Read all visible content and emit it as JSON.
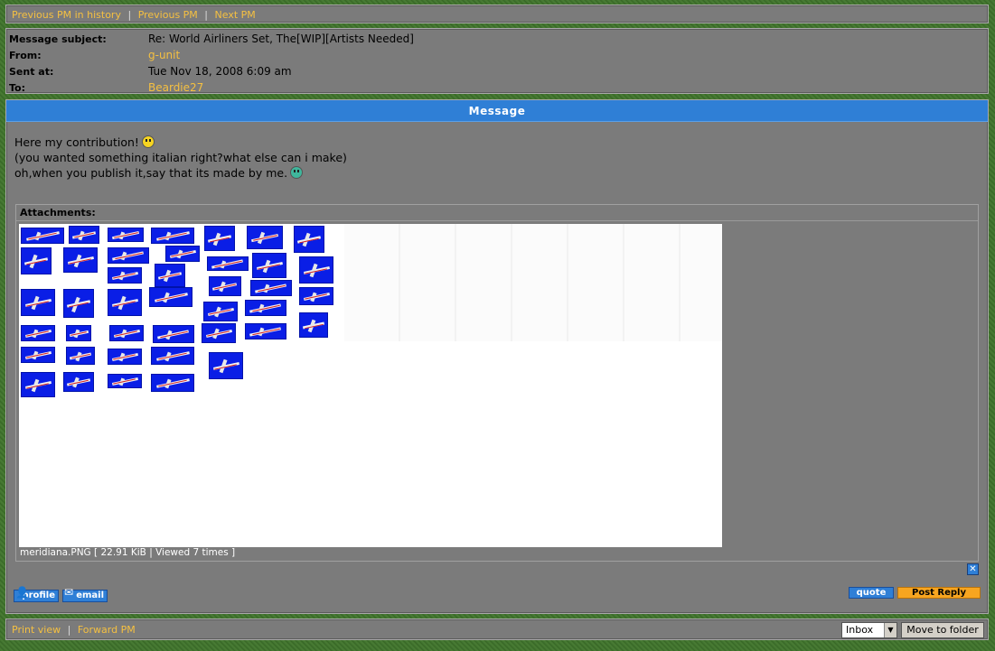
{
  "nav": {
    "prev_history": "Previous PM in history",
    "prev_pm": "Previous PM",
    "next_pm": "Next PM",
    "separator": "|"
  },
  "header": {
    "subject_label": "Message subject:",
    "subject_value": "Re: World Airliners Set, The[WIP][Artists Needed]",
    "from_label": "From:",
    "from_value": "g-unit",
    "sent_label": "Sent at:",
    "sent_value": "Tue Nov 18, 2008 6:09 am",
    "to_label": "To:",
    "to_value": "Beardie27"
  },
  "message": {
    "title": "Message",
    "line1": "Here my contribution!",
    "line2": "(you wanted something italian right?what else can i make)",
    "line3": "oh,when you publish it,say that its made by me."
  },
  "attachments": {
    "header": "Attachments:",
    "caption": "meridiana.PNG [ 22.91 KiB | Viewed 7 times ]"
  },
  "actions": {
    "quote": "quote",
    "post_reply": "Post Reply",
    "profile": "profile",
    "email": "email",
    "close": "✕"
  },
  "footer": {
    "print_view": "Print view",
    "forward_pm": "Forward PM",
    "separator": "|",
    "folder_selected": "Inbox",
    "move_button": "Move to folder"
  },
  "colors": {
    "link": "#f5c041",
    "panel": "#7b7b7b",
    "accent_blue": "#2f7fd6",
    "reply_orange": "#f7a520",
    "background_green": "#3a6b2a"
  }
}
